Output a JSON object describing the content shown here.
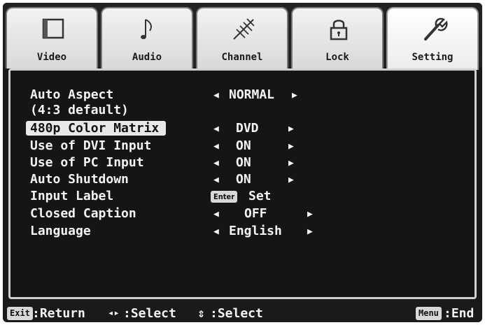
{
  "tabs": [
    {
      "label": "Video",
      "icon": "video-screen-icon",
      "active": false
    },
    {
      "label": "Audio",
      "icon": "music-note-icon",
      "active": false
    },
    {
      "label": "Channel",
      "icon": "antenna-icon",
      "active": false
    },
    {
      "label": "Lock",
      "icon": "padlock-icon",
      "active": false
    },
    {
      "label": "Setting",
      "icon": "wrench-icon",
      "active": true
    }
  ],
  "menu": {
    "items": [
      {
        "name": "Auto Aspect",
        "name2": "(4:3 default)",
        "value": "NORMAL"
      },
      {
        "name": "480p Color Matrix",
        "value": "DVD",
        "selected": true
      },
      {
        "name": "Use of DVI Input",
        "value": "ON"
      },
      {
        "name": "Use of PC Input",
        "value": "ON"
      },
      {
        "name": "Auto Shutdown",
        "value": "ON"
      },
      {
        "name": "Input Label",
        "key": "Enter",
        "value": "Set"
      },
      {
        "name": "Closed Caption",
        "value": "OFF"
      },
      {
        "name": "Language",
        "value": "English"
      }
    ]
  },
  "help": {
    "exit_key": "Exit",
    "exit_text": ":Return",
    "lr_symbol": "◂▸",
    "lr_text": ":Select",
    "ud_symbol": "⇕",
    "ud_text": ":Select",
    "menu_key": "Menu",
    "menu_text": ":End"
  }
}
